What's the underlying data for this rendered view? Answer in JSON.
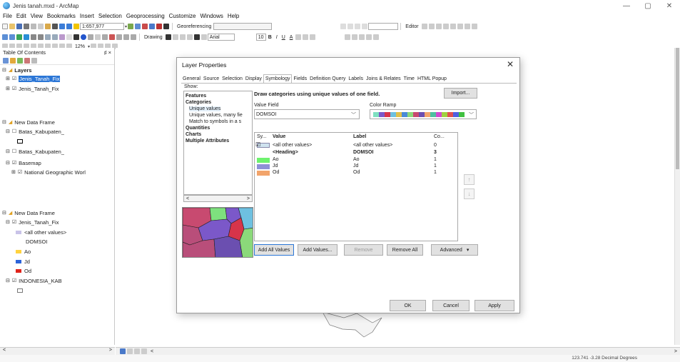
{
  "window": {
    "title": "Jenis tanah.mxd - ArcMap",
    "min": "—",
    "max": "▢",
    "close": "✕"
  },
  "menu": [
    "File",
    "Edit",
    "View",
    "Bookmarks",
    "Insert",
    "Selection",
    "Geoprocessing",
    "Customize",
    "Windows",
    "Help"
  ],
  "toolbar": {
    "scale": "1:657,977",
    "georeferencing": "Georeferencing",
    "editor": "Editor",
    "drawing": "Drawing",
    "font": "Arial",
    "font_size": "10",
    "zoom": "12%"
  },
  "toc": {
    "title": "Table Of Contents",
    "pin": "♯ ×",
    "layers_group": "Layers",
    "layer1": "Jenis_Tanah_Fix",
    "layer2": "Jenis_Tanah_Fix",
    "new_frame1": "New Data Frame",
    "batas1": "Batas_Kabupaten_",
    "batas2": "Batas_Kabupaten_",
    "basemap": "Basemap",
    "natgeo": "National Geographic Worl",
    "new_frame2": "New Data Frame",
    "layer3": "Jenis_Tanah_Fix",
    "all_other": "<all other values>",
    "domsoi": "DOMSOI",
    "ao": "Ao",
    "jd": "Jd",
    "od": "Od",
    "indo": "INDONESIA_KAB"
  },
  "dialog": {
    "title": "Layer Properties",
    "close": "✕",
    "tabs": [
      "General",
      "Source",
      "Selection",
      "Display",
      "Symbology",
      "Fields",
      "Definition Query",
      "Labels",
      "Joins & Relates",
      "Time",
      "HTML Popup"
    ],
    "active_tab": "Symbology",
    "show_label": "Show:",
    "show_items": {
      "features": "Features",
      "categories": "Categories",
      "unique": "Unique values",
      "unique_many": "Unique values, many fie",
      "match": "Match to symbols in a s",
      "quantities": "Quantities",
      "charts": "Charts",
      "multiple": "Multiple Attributes"
    },
    "description": "Draw categories using unique values of one field.",
    "import_label": "Import...",
    "value_field_label": "Value Field",
    "value_field": "DOMSOI",
    "color_ramp_label": "Color Ramp",
    "grid": {
      "headers": {
        "symbol": "Sy...",
        "value": "Value",
        "label": "Label",
        "count": "Co..."
      },
      "rows": [
        {
          "value": "<all other values>",
          "label": "<all other values>",
          "count": "0",
          "color": "#cfe3ef"
        },
        {
          "value": "<Heading>",
          "label": "DOMSOI",
          "count": "3",
          "color": ""
        },
        {
          "value": "Ao",
          "label": "Ao",
          "count": "1",
          "color": "#6ef26e"
        },
        {
          "value": "Jd",
          "label": "Jd",
          "count": "1",
          "color": "#8e91d6"
        },
        {
          "value": "Od",
          "label": "Od",
          "count": "1",
          "color": "#f2a46b"
        }
      ]
    },
    "buttons": {
      "add_all": "Add All Values",
      "add_values": "Add Values...",
      "remove": "Remove",
      "remove_all": "Remove All",
      "advanced": "Advanced",
      "ok": "OK",
      "cancel": "Cancel",
      "apply": "Apply"
    }
  },
  "status": {
    "coords": "123.741  -3.28 Decimal Degrees"
  },
  "colors": {
    "selection": "#2b76d6",
    "ao": "#ffd23f",
    "jd": "#2b63d9",
    "od": "#e0241b"
  }
}
